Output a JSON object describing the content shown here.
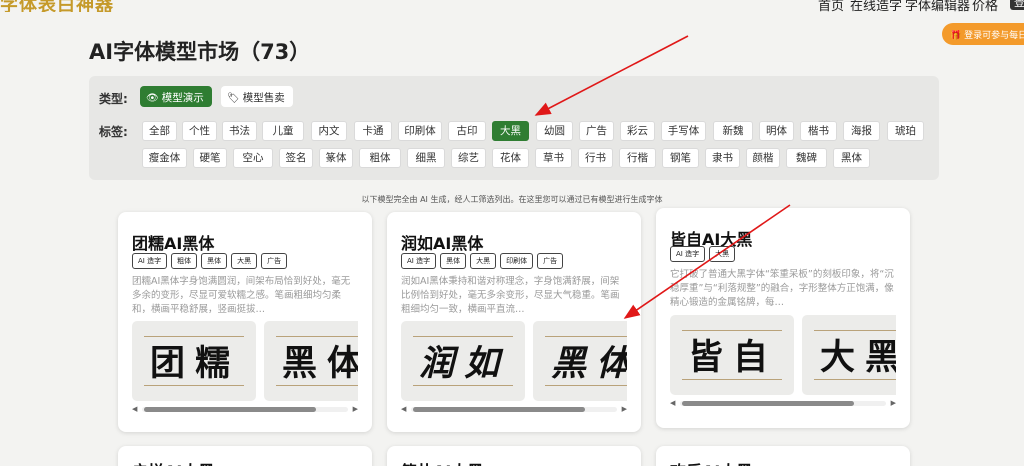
{
  "header": {
    "logo_text": "字体表白神器",
    "nav": [
      "首页",
      "在线造字",
      "字体编辑器",
      "价格"
    ],
    "login_label": "登录"
  },
  "promo": {
    "text": "登录可参与每日"
  },
  "page": {
    "title": "AI字体模型市场（73）"
  },
  "filter": {
    "type_label": "类型:",
    "types": [
      {
        "label": "模型演示",
        "icon": "eye-icon",
        "active": true
      },
      {
        "label": "模型售卖",
        "icon": "tag-icon",
        "active": false
      }
    ],
    "tag_label": "标签:",
    "tags_row1": [
      "全部",
      "个性",
      "书法",
      "儿童",
      "内文",
      "卡通",
      "印刷体",
      "古印",
      "大黑",
      "幼圆",
      "广告",
      "彩云",
      "手写体",
      "新魏",
      "明体",
      "楷书",
      "海报",
      "琥珀"
    ],
    "tags_row2": [
      "瘦金体",
      "硬笔",
      "空心",
      "签名",
      "篆体",
      "粗体",
      "细黑",
      "综艺",
      "花体",
      "草书",
      "行书",
      "行楷",
      "钢笔",
      "隶书",
      "颜楷",
      "魏碑",
      "黑体"
    ],
    "active_tag": "大黑",
    "accent_color": "#2f7d32"
  },
  "notice": "以下模型完全由 AI 生成，经人工筛选列出。在这里您可以通过已有模型进行生成字体",
  "cards": [
    {
      "title": "团糯AI黑体",
      "badges": [
        "AI 造字",
        "粗体",
        "黑体",
        "大黑",
        "广告"
      ],
      "desc": "团糯AI黑体字身饱满圆润，间架布局恰到好处，毫无多余的变形，尽显可爱软糯之感。笔画粗细均匀柔和，横画平稳舒展，竖画挺拔…",
      "previews": [
        "团糯",
        "黑体"
      ]
    },
    {
      "title": "润如AI黑体",
      "badges": [
        "AI 造字",
        "黑体",
        "大黑",
        "印刷体",
        "广告"
      ],
      "desc": "润如AI黑体秉持和谐对称理念，字身饱满舒展，间架比例恰到好处，毫无多余变形，尽显大气稳重。笔画粗细均匀一致，横画平直流…",
      "previews": [
        "润如",
        "黑体"
      ]
    },
    {
      "title": "皆自AI大黑",
      "badges": [
        "AI 造字",
        "大黑"
      ],
      "desc": "它打破了普通大黑字体“笨重呆板”的刻板印象，将“沉稳厚重”与“利落规整”的融合，字形整体方正饱满，像精心锻造的金属铭牌，每…",
      "previews": [
        "皆自",
        "大黑"
      ]
    }
  ],
  "bottom_cards": [
    "启悦AI大黑",
    "简朴AI大黑",
    "欢乐AI大黑"
  ]
}
